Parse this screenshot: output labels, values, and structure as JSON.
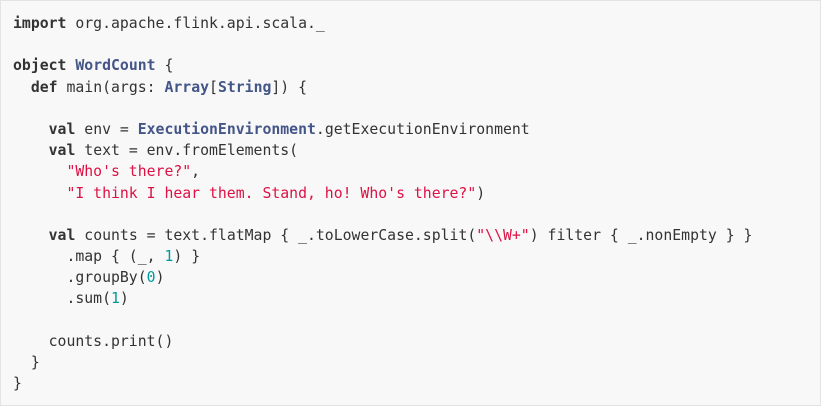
{
  "code": {
    "language": "scala",
    "lines": [
      [
        {
          "t": "kw",
          "v": "import"
        },
        {
          "t": "pl",
          "v": " org.apache.flink.api.scala._"
        }
      ],
      [],
      [
        {
          "t": "kw",
          "v": "object"
        },
        {
          "t": "pl",
          "v": " "
        },
        {
          "t": "ty",
          "v": "WordCount"
        },
        {
          "t": "pl",
          "v": " {"
        }
      ],
      [
        {
          "t": "pl",
          "v": "  "
        },
        {
          "t": "kw",
          "v": "def"
        },
        {
          "t": "pl",
          "v": " main(args: "
        },
        {
          "t": "ty",
          "v": "Array"
        },
        {
          "t": "pl",
          "v": "["
        },
        {
          "t": "ty",
          "v": "String"
        },
        {
          "t": "pl",
          "v": "]) {"
        }
      ],
      [],
      [
        {
          "t": "pl",
          "v": "    "
        },
        {
          "t": "kw",
          "v": "val"
        },
        {
          "t": "pl",
          "v": " env = "
        },
        {
          "t": "ty",
          "v": "ExecutionEnvironment"
        },
        {
          "t": "pl",
          "v": ".getExecutionEnvironment"
        }
      ],
      [
        {
          "t": "pl",
          "v": "    "
        },
        {
          "t": "kw",
          "v": "val"
        },
        {
          "t": "pl",
          "v": " text = env.fromElements("
        }
      ],
      [
        {
          "t": "pl",
          "v": "      "
        },
        {
          "t": "str",
          "v": "\"Who's there?\""
        },
        {
          "t": "pl",
          "v": ","
        }
      ],
      [
        {
          "t": "pl",
          "v": "      "
        },
        {
          "t": "str",
          "v": "\"I think I hear them. Stand, ho! Who's there?\""
        },
        {
          "t": "pl",
          "v": ")"
        }
      ],
      [],
      [
        {
          "t": "pl",
          "v": "    "
        },
        {
          "t": "kw",
          "v": "val"
        },
        {
          "t": "pl",
          "v": " counts = text.flatMap { _.toLowerCase.split("
        },
        {
          "t": "str",
          "v": "\"\\\\W+\""
        },
        {
          "t": "pl",
          "v": ") filter { _.nonEmpty } }"
        }
      ],
      [
        {
          "t": "pl",
          "v": "      .map { (_, "
        },
        {
          "t": "num",
          "v": "1"
        },
        {
          "t": "pl",
          "v": ") }"
        }
      ],
      [
        {
          "t": "pl",
          "v": "      .groupBy("
        },
        {
          "t": "num",
          "v": "0"
        },
        {
          "t": "pl",
          "v": ")"
        }
      ],
      [
        {
          "t": "pl",
          "v": "      .sum("
        },
        {
          "t": "num",
          "v": "1"
        },
        {
          "t": "pl",
          "v": ")"
        }
      ],
      [],
      [
        {
          "t": "pl",
          "v": "    counts.print()"
        }
      ],
      [
        {
          "t": "pl",
          "v": "  }"
        }
      ],
      [
        {
          "t": "pl",
          "v": "}"
        }
      ]
    ]
  },
  "colors": {
    "background": "#f8f8f8",
    "border": "#e3e3e3",
    "plain": "#333333",
    "keyword": "#333333",
    "type": "#445588",
    "string": "#dd1144",
    "number": "#009999"
  }
}
